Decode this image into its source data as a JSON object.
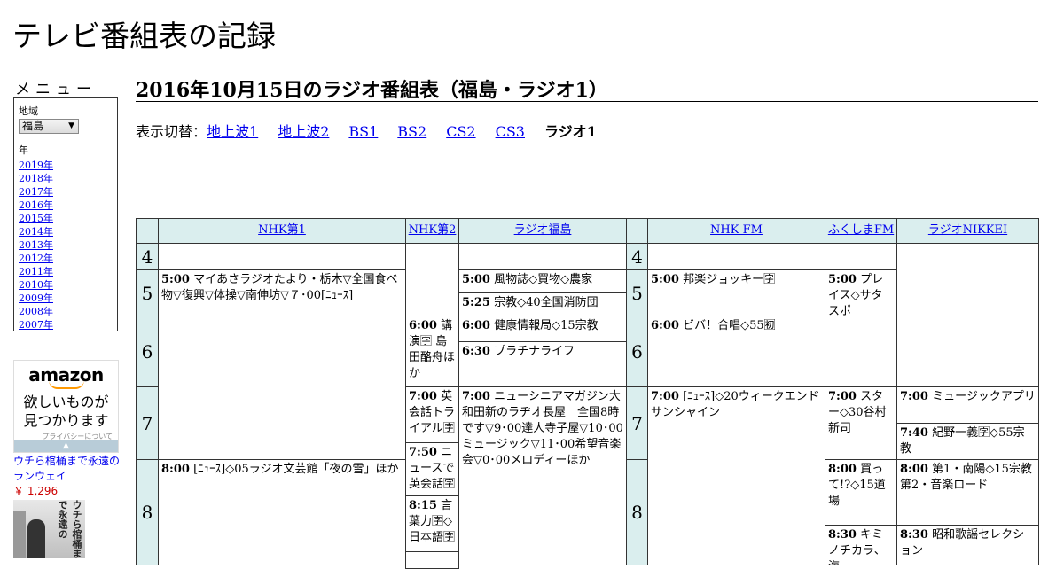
{
  "site_title": "テレビ番組表の記録",
  "menu": {
    "label": "メニュー",
    "region_label": "地域",
    "region_value": "福島",
    "year_label": "年",
    "years": [
      "2019年",
      "2018年",
      "2017年",
      "2016年",
      "2015年",
      "2014年",
      "2013年",
      "2012年",
      "2011年",
      "2010年",
      "2009年",
      "2008年",
      "2007年"
    ]
  },
  "ad": {
    "logo": "amazon",
    "tagline_1": "欲しいものが",
    "tagline_2": "見つかります",
    "privacy": "プライバシーについて",
    "book_title": "ウチら棺桶まで永遠のランウェイ",
    "book_price": "￥ 1,296",
    "book_cover_text": "ウチら棺桶まで永遠の"
  },
  "page_title": "2016年10月15日のラジオ番組表（福島・ラジオ1）",
  "switch": {
    "label": "表示切替：",
    "links": [
      "地上波1",
      "地上波2",
      "BS1",
      "BS2",
      "CS2",
      "CS3"
    ],
    "current": "ラジオ1"
  },
  "channels": [
    "NHK第1",
    "NHK第2",
    "ラジオ福島",
    "NHK FM",
    "ふくしまFM",
    "ラジオNIKKEI"
  ],
  "hours": [
    "4",
    "5",
    "6",
    "7",
    "8"
  ],
  "programs": {
    "nhk1_500_time": "5:00",
    "nhk1_500_title": "マイあさラジオたより・栃木▽全国食べ物▽復興▽体操▽南伸坊▽７･00[ﾆｭｰｽ]",
    "nhk1_800_time": "8:00",
    "nhk1_800_title": "[ﾆｭｰｽ]◇05ラジオ文芸館「夜の雪」ほか",
    "nhk2_600_time": "6:00",
    "nhk2_600_title": "講演🈑 島田酪舟ほか",
    "nhk2_700_time": "7:00",
    "nhk2_700_title": "英会話トライアル🈑",
    "nhk2_750_time": "7:50",
    "nhk2_750_title": "ニュースで英会話🈑",
    "nhk2_815_time": "8:15",
    "nhk2_815_title": "言葉力🈑◇日本語🈑",
    "rf_500_time": "5:00",
    "rf_500_title": "風物誌◇買物◇農家",
    "rf_525_time": "5:25",
    "rf_525_title": "宗教◇40全国消防団",
    "rf_600_time": "6:00",
    "rf_600_title": "健康情報局◇15宗教",
    "rf_630_time": "6:30",
    "rf_630_title": "プラチナライフ",
    "rf_700_time": "7:00",
    "rf_700_title": "ニューシニアマガジン大和田新のラヂオ長屋　全国8時です▽9･00達人寺子屋▽10･00ミュージック▽11･00希望音楽会▽0･00メロディーほか",
    "fm_500_time": "5:00",
    "fm_500_title": "邦楽ジョッキー🈑",
    "fm_600_time": "6:00",
    "fm_600_title": "ビバ！合唱◇55🈠",
    "fm_700_time": "7:00",
    "fm_700_title": "[ﾆｭｰｽ]◇20ウィークエンドサンシャイン",
    "ff_500_time": "5:00",
    "ff_500_title": "プレイス◇サタスポ",
    "ff_700_time": "7:00",
    "ff_700_title": "スター◇30谷村新司",
    "ff_800_time": "8:00",
    "ff_800_title": "買って!?◇15道場",
    "ff_830_time": "8:30",
    "ff_830_title": "キミノチカラ、海",
    "nk_700_time": "7:00",
    "nk_700_title": "ミュージックアプリ",
    "nk_740_time": "7:40",
    "nk_740_title": "紀野一義🈑◇55宗教",
    "nk_800_time": "8:00",
    "nk_800_title": "第1・南陽◇15宗教第2・音楽ロード",
    "nk_830_time": "8:30",
    "nk_830_title": "昭和歌謡セレクション"
  }
}
